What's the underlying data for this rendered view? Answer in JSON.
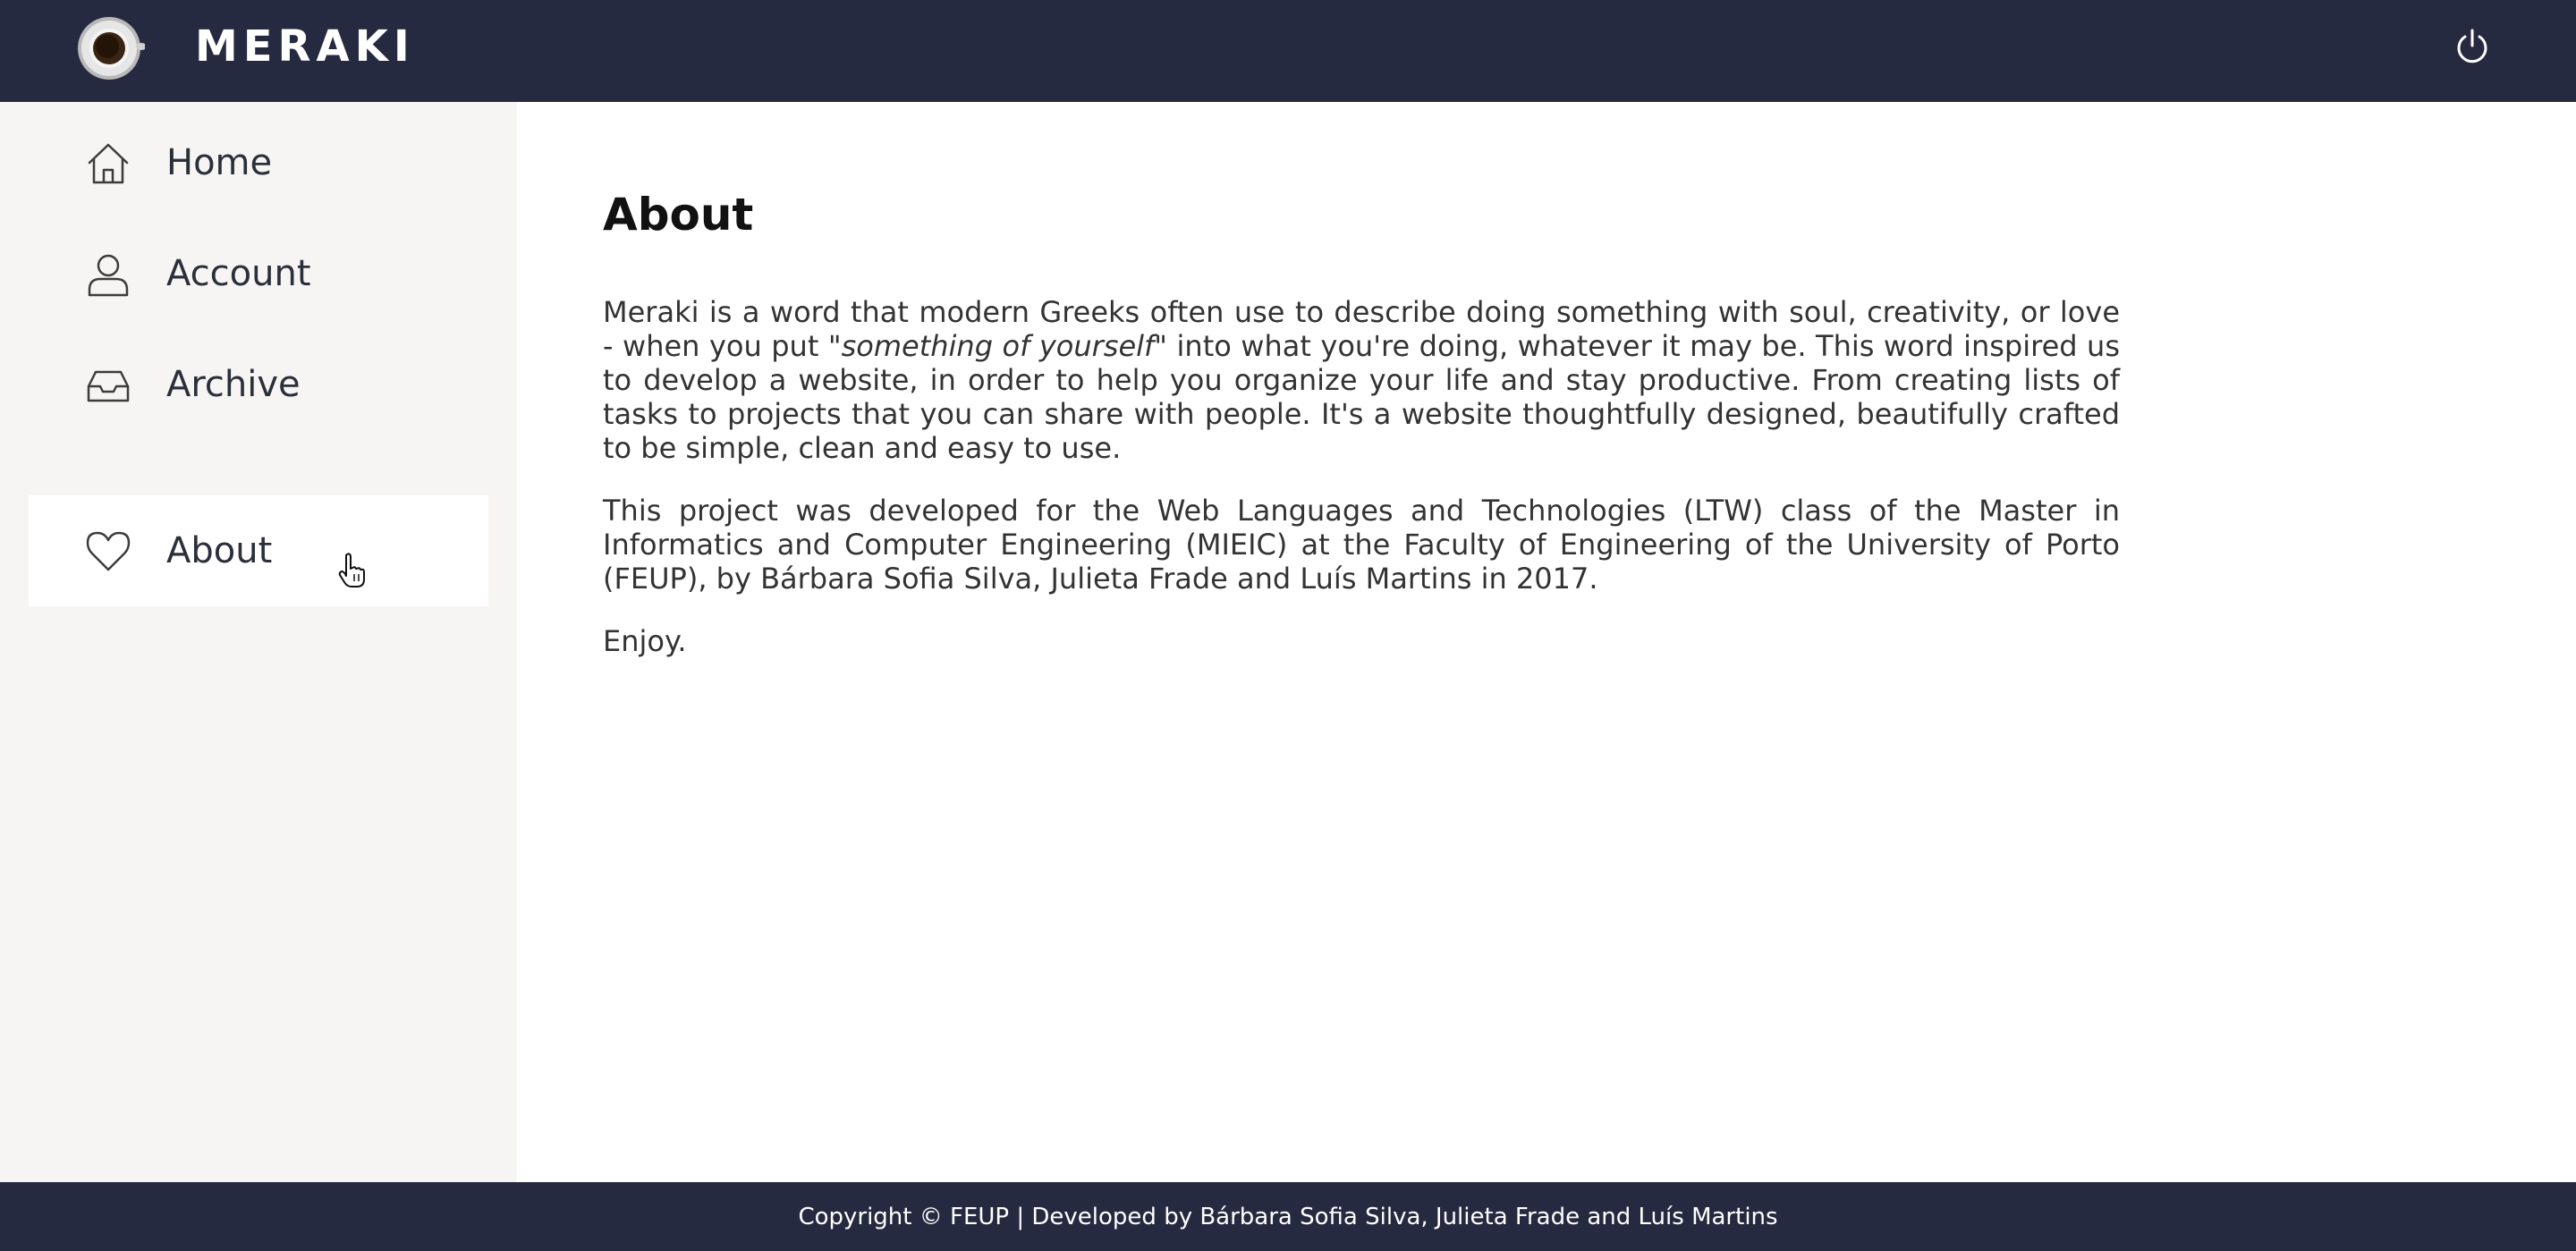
{
  "header": {
    "brand": "MERAKI",
    "logo_icon": "coffee-cup-logo-icon",
    "power_icon": "power-icon",
    "background": "#262a40"
  },
  "sidebar": {
    "background": "#f6f5f3",
    "items": [
      {
        "label": "Home",
        "icon": "home-icon",
        "active": false
      },
      {
        "label": "Account",
        "icon": "user-icon",
        "active": false
      },
      {
        "label": "Archive",
        "icon": "inbox-icon",
        "active": false
      },
      {
        "label": "About",
        "icon": "heart-icon",
        "active": true
      }
    ]
  },
  "main": {
    "title": "About",
    "paragraph1_before": "Meraki is a word that modern Greeks often use to describe doing something with soul, creativity, or love - when you put ",
    "paragraph1_emphasis": "\"something of yourself\"",
    "paragraph1_after": " into what you're doing, whatever it may be. This word inspired us to develop a website, in order to help you organize your life and stay productive. From creating lists of tasks to projects that you can share with people. It's a website thoughtfully designed, beautifully crafted to be simple, clean and easy to use.",
    "paragraph2": "This project was developed for the Web Languages and Technologies (LTW) class of the Master in Informatics and Computer Engineering (MIEIC) at the Faculty of Engineering of the University of Porto (FEUP), by Bárbara Sofia Silva, Julieta Frade and Luís Martins in 2017.",
    "paragraph3": "Enjoy."
  },
  "footer": {
    "text": "Copyright © FEUP | Developed by Bárbara Sofia Silva, Julieta Frade and Luís Martins"
  }
}
